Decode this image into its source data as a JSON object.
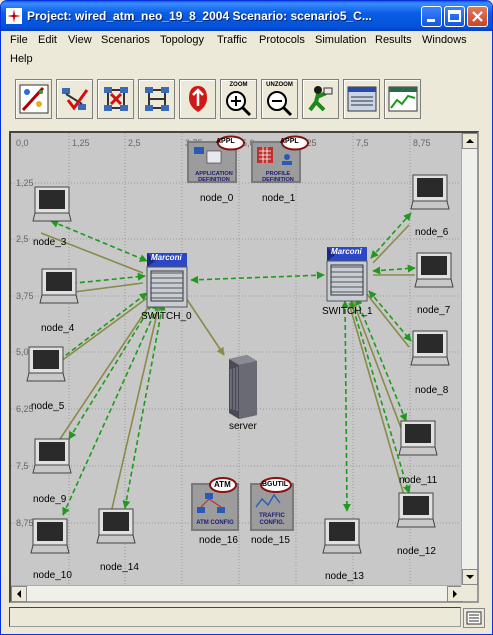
{
  "window": {
    "title": "Project: wired_atm_neo_19_8_2004 Scenario: scenario5_C..."
  },
  "menu": [
    {
      "label": "File"
    },
    {
      "label": "Edit"
    },
    {
      "label": "View"
    },
    {
      "label": "Scenarios"
    },
    {
      "label": "Topology"
    },
    {
      "label": "Traffic"
    },
    {
      "label": "Protocols"
    },
    {
      "label": "Simulation"
    },
    {
      "label": "Results"
    },
    {
      "label": "Windows"
    },
    {
      "label": "Help"
    }
  ],
  "toolbar": {
    "zoom_label": "ZOOM",
    "unzoom_label": "UNZOOM",
    "tools": [
      {
        "icon": "object-palette-icon"
      },
      {
        "icon": "verify-links-icon"
      },
      {
        "icon": "failed-node-icon"
      },
      {
        "icon": "recover-node-icon"
      },
      {
        "icon": "return-to-parent-icon"
      },
      {
        "icon": "zoom-in-icon"
      },
      {
        "icon": "zoom-out-icon"
      },
      {
        "icon": "configure-simulation-icon"
      },
      {
        "icon": "view-results-icon"
      },
      {
        "icon": "hide-graphs-icon"
      }
    ]
  },
  "ruler": {
    "x": [
      "0,0",
      "1,25",
      "2,5",
      "3,75",
      "5,0",
      "6,25",
      "7,5",
      "8,75"
    ],
    "y": [
      "1,25",
      "2,5",
      "3,75",
      "5,0",
      "6,25",
      "7,5",
      "8,75"
    ]
  },
  "nodes": {
    "node_0": {
      "label": "node_0",
      "badge": "APPL",
      "caption1": "APPLICATION",
      "caption2": "DEFINITION"
    },
    "node_1": {
      "label": "node_1",
      "badge": "APPL",
      "caption1": "PROFILE",
      "caption2": "DEFINITION"
    },
    "node_16": {
      "label": "node_16",
      "badge": "ATM",
      "caption1": "ATM CONFIG",
      "caption2": ""
    },
    "node_15": {
      "label": "node_15",
      "badge": "BGUTIL",
      "caption1": "TRAFFIC",
      "caption2": "CONFIG."
    },
    "switch_0": {
      "label": "SWITCH_0",
      "brand": "Marconi"
    },
    "switch_1": {
      "label": "SWITCH_1",
      "brand": "Marconi"
    },
    "server": {
      "label": "server"
    },
    "node_3": {
      "label": "node_3"
    },
    "node_4": {
      "label": "node_4"
    },
    "node_5": {
      "label": "node_5"
    },
    "node_9": {
      "label": "node_9"
    },
    "node_10": {
      "label": "node_10"
    },
    "node_14": {
      "label": "node_14"
    },
    "node_6": {
      "label": "node_6"
    },
    "node_7": {
      "label": "node_7"
    },
    "node_8": {
      "label": "node_8"
    },
    "node_11": {
      "label": "node_11"
    },
    "node_12": {
      "label": "node_12"
    },
    "node_13": {
      "label": "node_13"
    }
  },
  "colors": {
    "link_green": "#1f9a1f",
    "link_olive": "#8a8a4a",
    "title_blue": "#0a5ee6",
    "badge_red": "#8b1010"
  }
}
